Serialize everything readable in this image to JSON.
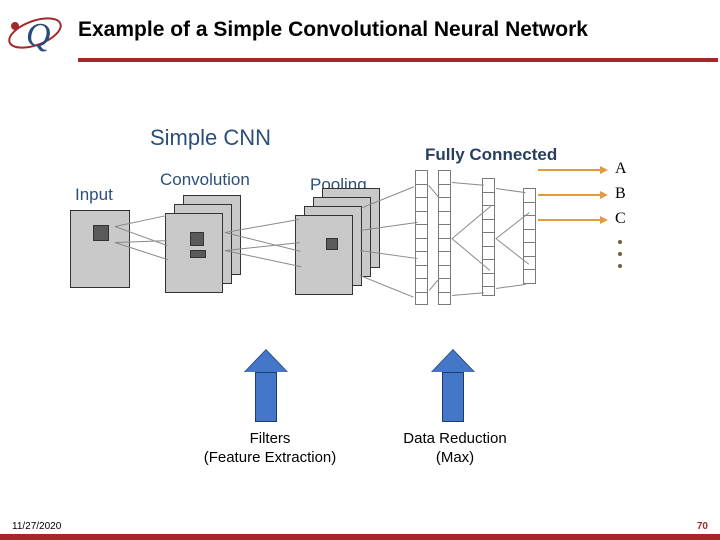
{
  "header": {
    "title": "Example of a Simple Convolutional Neural Network"
  },
  "diagram": {
    "title": "Simple CNN",
    "stages": {
      "input": "Input",
      "convolution": "Convolution",
      "pooling": "Pooling",
      "fully_connected": "Fully Connected"
    },
    "outputs": {
      "a": "A",
      "b": "B",
      "c": "C"
    }
  },
  "annotations": {
    "filters_line1": "Filters",
    "filters_line2": "(Feature Extraction)",
    "pooling_line1": "Data Reduction",
    "pooling_line2": "(Max)"
  },
  "footer": {
    "date": "11/27/2020",
    "page": "70"
  },
  "colors": {
    "accent": "#a4282a",
    "arrow": "#4577c8",
    "section_label": "#2c4f7a",
    "out_arrow": "#e29a3b"
  }
}
